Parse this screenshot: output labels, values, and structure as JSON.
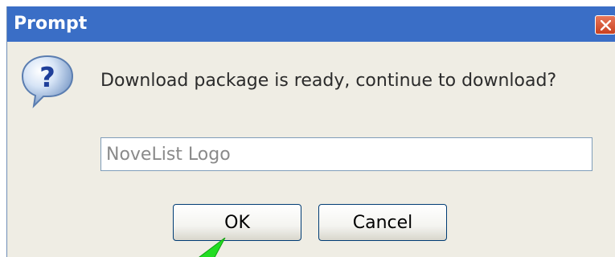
{
  "window": {
    "title": "Prompt"
  },
  "icons": {
    "question": "question-icon",
    "close": "close-icon",
    "cursor": "cursor-arrow-icon"
  },
  "dialog": {
    "message": "Download package is ready, continue to download?",
    "input_value": "NoveList Logo"
  },
  "buttons": {
    "ok_label": "OK",
    "cancel_label": "Cancel"
  },
  "colors": {
    "titlebar": "#3a6ec6",
    "dialog_background": "#efede4",
    "close_button": "#d4502c",
    "cursor": "#22dd22"
  }
}
